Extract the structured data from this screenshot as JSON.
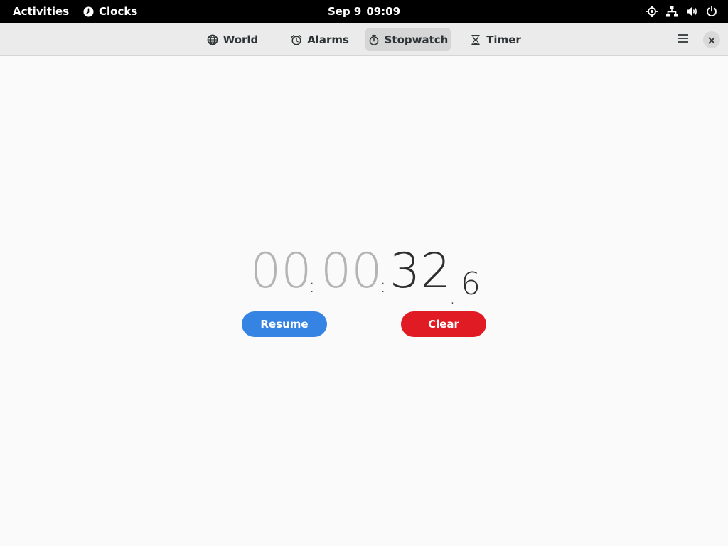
{
  "topbar": {
    "activities": "Activities",
    "app_name": "Clocks",
    "date": "Sep 9",
    "time": "09:09"
  },
  "tabs": [
    {
      "label": "World",
      "icon": "globe-icon"
    },
    {
      "label": "Alarms",
      "icon": "alarm-clock-icon"
    },
    {
      "label": "Stopwatch",
      "icon": "stopwatch-icon",
      "active": true
    },
    {
      "label": "Timer",
      "icon": "hourglass-icon"
    }
  ],
  "stopwatch": {
    "hours": "00",
    "minutes": "00",
    "seconds": "32",
    "tenths": "6",
    "sep_colon": ":",
    "sep_dot": "."
  },
  "buttons": {
    "resume": "Resume",
    "clear": "Clear"
  },
  "colors": {
    "accent_blue": "#3584e4",
    "destructive_red": "#e01b24",
    "topbar_bg": "#000000",
    "headerbar_bg": "#ebebeb",
    "window_bg": "#fafafa"
  }
}
